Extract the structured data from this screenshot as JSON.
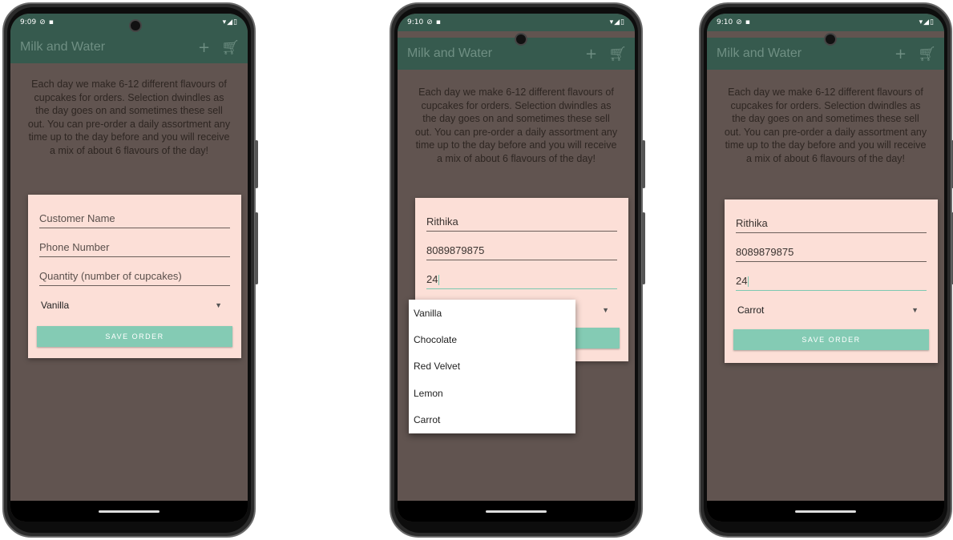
{
  "app": {
    "title": "Milk and Water",
    "add_icon": "+",
    "cart_icon": "cart-icon",
    "description": "Each day we make 6-12 different flavours of cupcakes for orders. Selection dwindles as the day goes on and sometimes these sell out. You can pre-order a daily assortment any time up to the day before and you will receive a mix of about 6 flavours of the day!",
    "save_label": "SAVE ORDER"
  },
  "colors": {
    "appbar": "#365a4e",
    "background": "#615450",
    "card": "#fcdfd7",
    "button": "#84cbb4"
  },
  "screens": [
    {
      "time": "9:09",
      "name_field": "Customer Name",
      "phone_field": "Phone Number",
      "quantity_field": "Quantity (number of cupcakes)",
      "flavour": "Vanilla"
    },
    {
      "time": "9:10",
      "name_field": "Rithika",
      "phone_field": "8089879875",
      "quantity_field": "24",
      "dropdown_options": [
        "Vanilla",
        "Chocolate",
        "Red Velvet",
        "Lemon",
        "Carrot"
      ]
    },
    {
      "time": "9:10",
      "name_field": "Rithika",
      "phone_field": "8089879875",
      "quantity_field": "24",
      "flavour": "Carrot"
    }
  ]
}
